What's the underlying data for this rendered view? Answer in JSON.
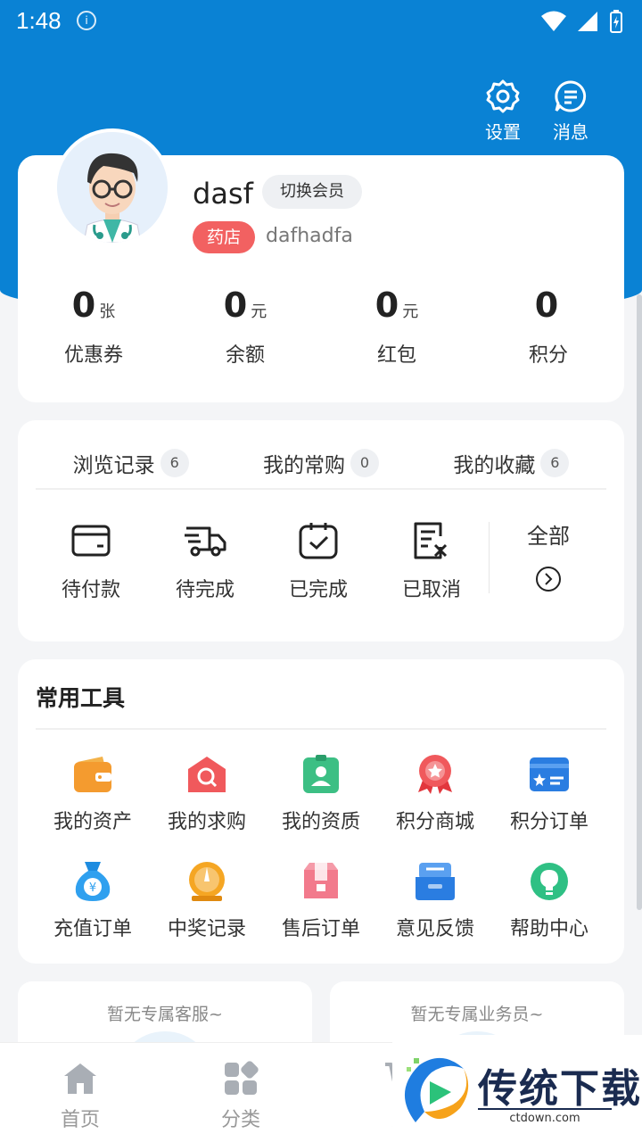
{
  "status_bar": {
    "time": "1:48",
    "sim_icon": "sim-icon"
  },
  "header_actions": [
    {
      "label": "设置",
      "icon": "gear-icon"
    },
    {
      "label": "消息",
      "icon": "message-icon"
    }
  ],
  "profile": {
    "username": "dasf",
    "switch_label": "切换会员",
    "tag": "药店",
    "store_name": "dafhadfa",
    "stats": [
      {
        "value": "0",
        "unit": "张",
        "label": "优惠券"
      },
      {
        "value": "0",
        "unit": "元",
        "label": "余额"
      },
      {
        "value": "0",
        "unit": "元",
        "label": "红包"
      },
      {
        "value": "0",
        "unit": "",
        "label": "积分"
      }
    ]
  },
  "order_tabs": [
    {
      "label": "浏览记录",
      "count": "6"
    },
    {
      "label": "我的常购",
      "count": "0"
    },
    {
      "label": "我的收藏",
      "count": "6"
    }
  ],
  "order_statuses": [
    {
      "label": "待付款",
      "icon": "wallet-icon"
    },
    {
      "label": "待完成",
      "icon": "truck-icon"
    },
    {
      "label": "已完成",
      "icon": "clipboard-check-icon"
    },
    {
      "label": "已取消",
      "icon": "document-cancel-icon"
    }
  ],
  "order_all": "全部",
  "tools": {
    "title": "常用工具",
    "items": [
      {
        "label": "我的资产",
        "icon": "wallet-icon"
      },
      {
        "label": "我的求购",
        "icon": "search-house-icon"
      },
      {
        "label": "我的资质",
        "icon": "badge-icon"
      },
      {
        "label": "积分商城",
        "icon": "medal-icon"
      },
      {
        "label": "积分订单",
        "icon": "card-icon"
      },
      {
        "label": "充值订单",
        "icon": "money-bag-icon"
      },
      {
        "label": "中奖记录",
        "icon": "timer-icon"
      },
      {
        "label": "售后订单",
        "icon": "gift-box-icon"
      },
      {
        "label": "意见反馈",
        "icon": "inbox-icon"
      },
      {
        "label": "帮助中心",
        "icon": "bulb-icon"
      }
    ]
  },
  "service": {
    "left": "暂无专属客服~",
    "right": "暂无专属业务员~"
  },
  "tab_bar": [
    {
      "label": "首页",
      "icon": "home-icon"
    },
    {
      "label": "分类",
      "icon": "category-icon"
    },
    {
      "label": "购",
      "icon": "cart-icon"
    },
    {
      "label": "",
      "icon": ""
    }
  ],
  "watermark": {
    "text": "传统下载",
    "url": "ctdown.com"
  },
  "colors": {
    "brand": "#0a82d4",
    "tag": "#f26161"
  }
}
